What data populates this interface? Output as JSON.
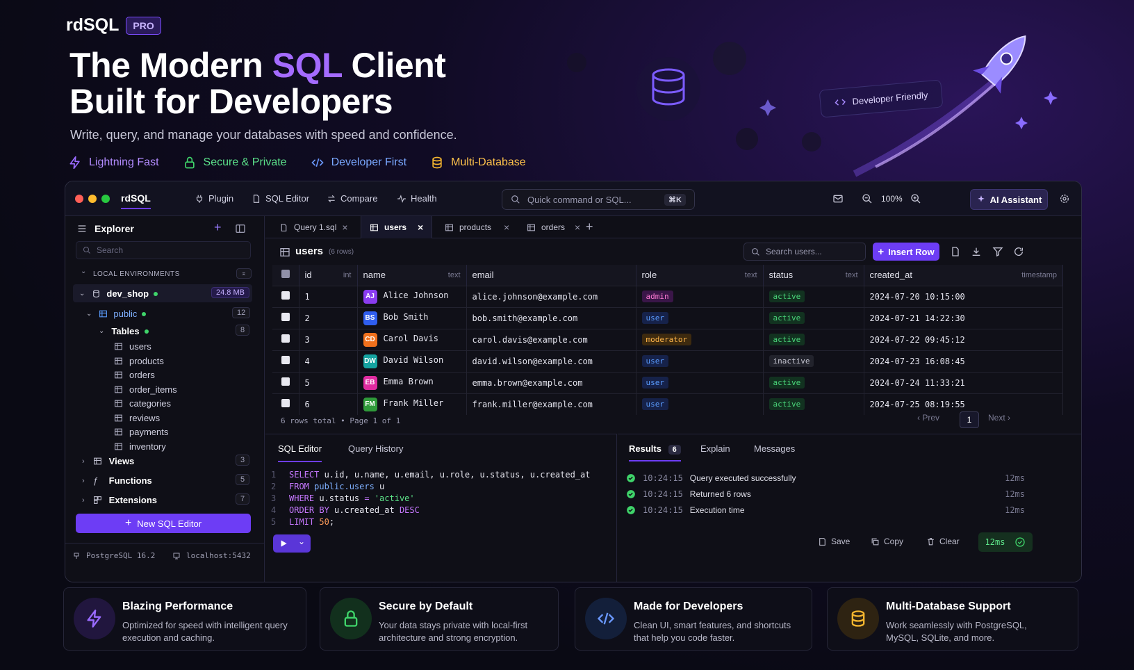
{
  "brand": {
    "name": "rdSQL",
    "badge": "PRO"
  },
  "hero": {
    "title_a": "The Modern ",
    "title_accent": "SQL",
    "title_b": " Client",
    "title_line2": "Built for Developers",
    "subtitle": "Write, query, and manage your databases with speed and confidence.",
    "dev_tag": "Developer Friendly"
  },
  "features": [
    {
      "label": "Lightning Fast",
      "color": "#b28bff",
      "icon": "lightning-icon"
    },
    {
      "label": "Secure & Private",
      "color": "#5be08a",
      "icon": "lock-icon"
    },
    {
      "label": "Developer First",
      "color": "#7aa8ff",
      "icon": "code-icon"
    },
    {
      "label": "Multi-Database",
      "color": "#ffc24a",
      "icon": "database-icon"
    }
  ],
  "titlebar": {
    "app": "rdSQL",
    "nav": [
      "Plugin",
      "SQL Editor",
      "Compare",
      "Health"
    ],
    "search_placeholder": "Quick command or SQL...",
    "shortcut": "⌘K",
    "zoom": "100%",
    "ai": "AI Assistant"
  },
  "sidebar": {
    "title": "Explorer",
    "search_placeholder": "Search",
    "env_label": "LOCAL ENVIRONMENTS",
    "db": {
      "name": "dev_shop",
      "size": "24.8 MB"
    },
    "schema": {
      "name": "public",
      "count": "12"
    },
    "tables_group": {
      "name": "Tables",
      "count": "8"
    },
    "tables": [
      "users",
      "products",
      "orders",
      "order_items",
      "categories",
      "reviews",
      "payments",
      "inventory"
    ],
    "groups": [
      {
        "name": "Views",
        "count": "3"
      },
      {
        "name": "Functions",
        "count": "5"
      },
      {
        "name": "Extensions",
        "count": "7"
      }
    ],
    "new_btn": "New SQL Editor",
    "status_db": "PostgreSQL 16.2",
    "status_host": "localhost:5432"
  },
  "tabs": [
    {
      "label": "Query 1.sql"
    },
    {
      "label": "users"
    },
    {
      "label": "products"
    },
    {
      "label": "orders"
    }
  ],
  "grid": {
    "title": "users",
    "rowcount": "(6 rows)",
    "search_placeholder": "Search users...",
    "insert": "Insert Row",
    "columns": [
      {
        "name": "id",
        "type": "int"
      },
      {
        "name": "name",
        "type": "text"
      },
      {
        "name": "email",
        "type": ""
      },
      {
        "name": "role",
        "type": "text"
      },
      {
        "name": "status",
        "type": "text"
      },
      {
        "name": "created_at",
        "type": "timestamp"
      }
    ],
    "rows": [
      {
        "id": "1",
        "initials": "AJ",
        "avatar": "#8a3cf0",
        "name": "Alice Johnson",
        "email": "alice.johnson@example.com",
        "role": "admin",
        "status": "active",
        "created": "2024-07-20 10:15:00"
      },
      {
        "id": "2",
        "initials": "BS",
        "avatar": "#2f5ef0",
        "name": "Bob Smith",
        "email": "bob.smith@example.com",
        "role": "user",
        "status": "active",
        "created": "2024-07-21 14:22:30"
      },
      {
        "id": "3",
        "initials": "CD",
        "avatar": "#f0701c",
        "name": "Carol Davis",
        "email": "carol.davis@example.com",
        "role": "moderator",
        "status": "active",
        "created": "2024-07-22 09:45:12"
      },
      {
        "id": "4",
        "initials": "DW",
        "avatar": "#15a3a0",
        "name": "David Wilson",
        "email": "david.wilson@example.com",
        "role": "user",
        "status": "inactive",
        "created": "2024-07-23 16:08:45"
      },
      {
        "id": "5",
        "initials": "EB",
        "avatar": "#e02ba0",
        "name": "Emma Brown",
        "email": "emma.brown@example.com",
        "role": "user",
        "status": "active",
        "created": "2024-07-24 11:33:21"
      },
      {
        "id": "6",
        "initials": "FM",
        "avatar": "#2f9a3a",
        "name": "Frank Miller",
        "email": "frank.miller@example.com",
        "role": "user",
        "status": "active",
        "created": "2024-07-25 08:19:55"
      }
    ],
    "footer": "6 rows total • Page 1 of 1",
    "prev": "Prev",
    "page": "1",
    "next": "Next"
  },
  "editor": {
    "tab1": "SQL Editor",
    "tab2": "Query History",
    "lines": [
      "1",
      "2",
      "3",
      "4",
      "5"
    ],
    "code": {
      "l1a": "SELECT",
      "l1b": " u.id, u.name, u.email, u.role, u.status, u.created_at",
      "l2a": "FROM",
      "l2b": " public.users",
      "l2c": " u",
      "l3a": "WHERE",
      "l3b": " u.status ",
      "l3c": "=",
      "l3d": " 'active'",
      "l4a": "ORDER BY",
      "l4b": " u.created_at ",
      "l4c": "DESC",
      "l5a": "LIMIT",
      "l5b": " 50",
      "l5c": ";"
    }
  },
  "results": {
    "tab1": "Results",
    "tab1_count": "6",
    "tab2": "Explain",
    "tab3": "Messages",
    "messages": [
      {
        "time": "10:24:15",
        "text": "Query executed successfully",
        "ms": "12ms"
      },
      {
        "time": "10:24:15",
        "text": "Returned 6 rows",
        "ms": "12ms"
      },
      {
        "time": "10:24:15",
        "text": "Execution time",
        "ms": "12ms"
      }
    ],
    "save": "Save",
    "copy": "Copy",
    "clear": "Clear",
    "timing": "12ms"
  },
  "cards": [
    {
      "title": "Blazing Performance",
      "desc": "Optimized for speed with intelligent query execution and caching.",
      "icon": "lightning-icon"
    },
    {
      "title": "Secure by Default",
      "desc": "Your data stays private with local-first architecture and strong encryption.",
      "icon": "lock-icon"
    },
    {
      "title": "Made for Developers",
      "desc": "Clean UI, smart features, and shortcuts that help you code faster.",
      "icon": "code-icon"
    },
    {
      "title": "Multi-Database Support",
      "desc": "Work seamlessly with PostgreSQL, MySQL, SQLite, and more.",
      "icon": "database-icon"
    }
  ]
}
